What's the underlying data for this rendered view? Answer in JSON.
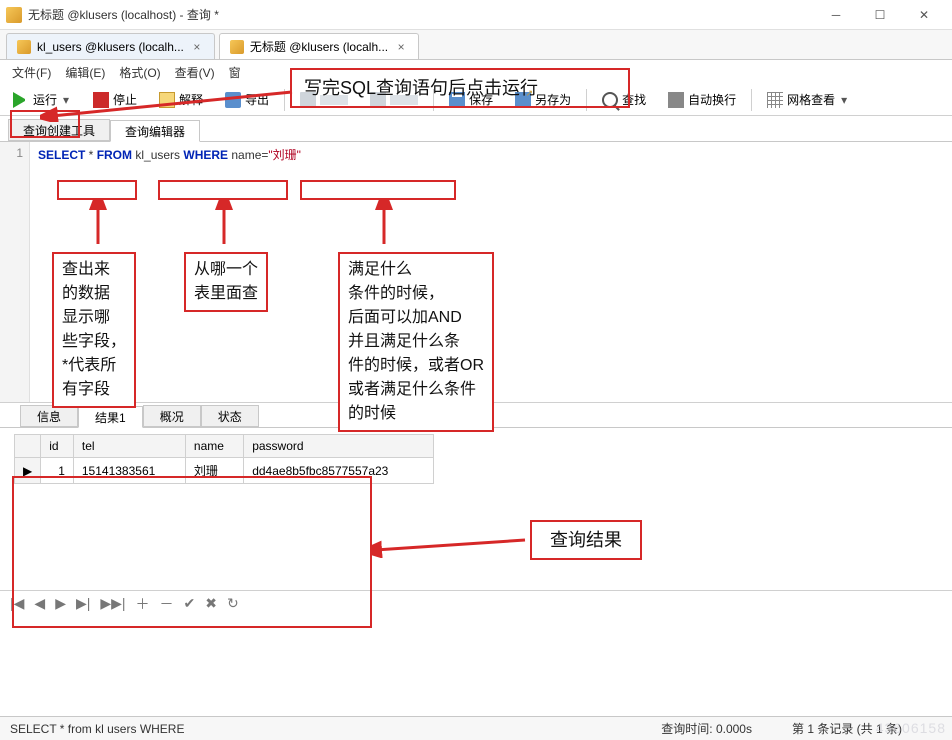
{
  "window": {
    "title": "无标题 @klusers (localhost) - 查询 *"
  },
  "doc_tabs": [
    {
      "label": "kl_users @klusers (localh...",
      "active": false
    },
    {
      "label": "无标题 @klusers (localh...",
      "active": true
    }
  ],
  "menus": {
    "file": "文件(F)",
    "edit": "编辑(E)",
    "format": "格式(O)",
    "view": "查看(V)",
    "window_trim": "窗"
  },
  "toolbar": {
    "run": "运行",
    "stop": "停止",
    "explain": "解释",
    "export": "导出",
    "save": "保存",
    "saveas": "另存为",
    "find": "查找",
    "wrap": "自动换行",
    "gridview": "网格查看"
  },
  "sub_tabs": {
    "builder": "查询创建工具",
    "editor": "查询编辑器"
  },
  "sql": {
    "line_no": "1",
    "select": "SELECT",
    "star": " * ",
    "from": "FROM",
    "table": " kl_users ",
    "where": "WHERE",
    "cond_field": " name=",
    "cond_value": "\"刘珊\""
  },
  "res_tabs": {
    "info": "信息",
    "result1": "结果1",
    "profile": "概况",
    "status": "状态"
  },
  "result_table": {
    "headers": [
      "id",
      "tel",
      "name",
      "password"
    ],
    "rows": [
      {
        "marker": "▶",
        "id": "1",
        "tel": "15141383561",
        "name": "刘珊",
        "password": "dd4ae8b5fbc8577557a23"
      }
    ]
  },
  "res_nav": {
    "first": "|◀",
    "prev": "◀",
    "play": "▶",
    "next": "▶|",
    "fastend": "▶▶|",
    "plus": "＋",
    "minus": "－",
    "check": "✔",
    "x": "✖",
    "refresh": "↻"
  },
  "statusbar": {
    "sql": "SELECT * from kl users WHERE",
    "time": "查询时间: 0.000s",
    "record": "第 1 条记录 (共 1 条)"
  },
  "annotations": {
    "tip": "写完SQL查询语句后点击运行",
    "select_note": "查出来\n的数据\n显示哪\n些字段，\n*代表所\n有字段",
    "from_note": "从哪一个\n表里面查",
    "where_note": "满足什么\n条件的时候，\n后面可以加AND\n并且满足什么条\n件的时候，或者OR\n或者满足什么条件\n的时候",
    "result_note": "查询结果"
  }
}
